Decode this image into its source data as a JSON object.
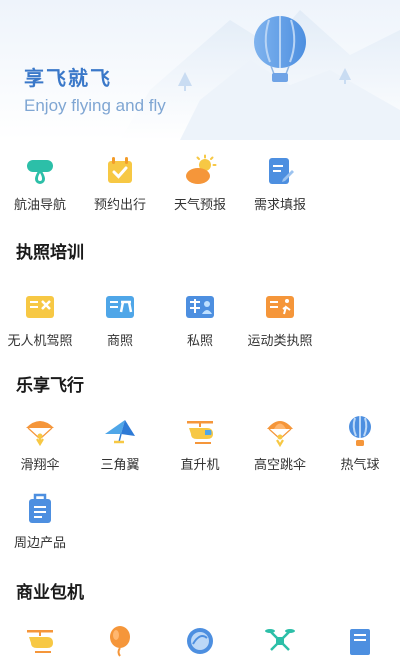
{
  "hero": {
    "title": "享飞就飞",
    "subtitle": "Enjoy flying and fly"
  },
  "quick_items": [
    {
      "label": "航油导航",
      "icon": "fuel-station-icon"
    },
    {
      "label": "预约出行",
      "icon": "calendar-check-icon"
    },
    {
      "label": "天气预报",
      "icon": "weather-sun-cloud-icon"
    },
    {
      "label": "需求填报",
      "icon": "form-edit-icon"
    }
  ],
  "sections": {
    "license": {
      "title": "执照培训",
      "items": [
        {
          "label": "无人机驾照",
          "icon": "drone-license-icon"
        },
        {
          "label": "商照",
          "icon": "commercial-license-icon"
        },
        {
          "label": "私照",
          "icon": "private-license-icon"
        },
        {
          "label": "运动类执照",
          "icon": "sport-license-icon"
        }
      ]
    },
    "fun": {
      "title": "乐享飞行",
      "items": [
        {
          "label": "滑翔伞",
          "icon": "paraglider-icon"
        },
        {
          "label": "三角翼",
          "icon": "hang-glider-icon"
        },
        {
          "label": "直升机",
          "icon": "helicopter-icon"
        },
        {
          "label": "高空跳伞",
          "icon": "skydiving-icon"
        },
        {
          "label": "热气球",
          "icon": "hot-air-balloon-icon"
        },
        {
          "label": "周边产品",
          "icon": "product-bag-icon"
        }
      ]
    },
    "charter": {
      "title": "商业包机",
      "items": [
        {
          "icon": "charter-helicopter-icon"
        },
        {
          "icon": "charter-balloon-icon"
        },
        {
          "icon": "charter-globe-icon"
        },
        {
          "icon": "charter-drone-icon"
        },
        {
          "icon": "charter-book-icon"
        }
      ]
    }
  },
  "colors": {
    "accent_blue": "#3a78c9",
    "accent_orange": "#f5963a",
    "accent_yellow": "#f7c844",
    "accent_teal": "#2cbfa8"
  }
}
